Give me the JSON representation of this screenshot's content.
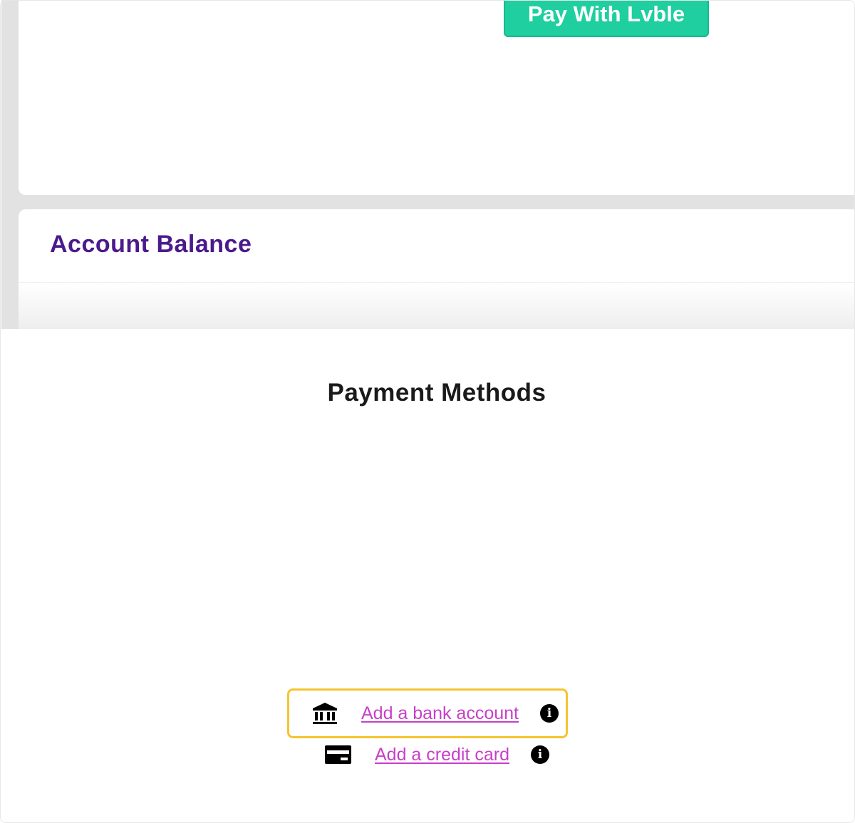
{
  "top_card": {
    "pay_button_label": "Pay With Lvble"
  },
  "account_balance": {
    "title": "Account Balance"
  },
  "payment_methods": {
    "title": "Payment Methods",
    "options": [
      {
        "label": "Add a bank account",
        "icon": "bank-icon",
        "info_icon": "info-icon"
      },
      {
        "label": "Add a credit card",
        "icon": "credit-card-icon",
        "info_icon": "info-icon"
      }
    ]
  },
  "colors": {
    "brand_purple": "#4b1a8c",
    "pay_button_green": "#1fcf9f",
    "link_magenta": "#c83ec9",
    "highlight_yellow": "#f5c431"
  }
}
